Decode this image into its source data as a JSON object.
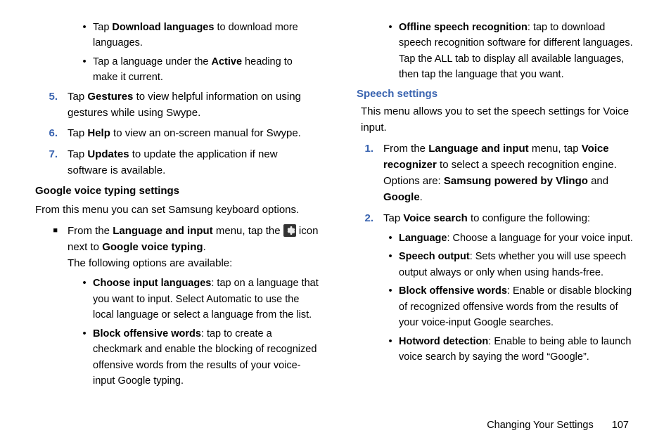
{
  "left": {
    "b_download_pre": "Tap ",
    "b_download_strong": "Download languages",
    "b_download_post": " to download more languages.",
    "b_active_pre": "Tap a language under the ",
    "b_active_strong": "Active",
    "b_active_post": " heading to make it current.",
    "n5_num": "5.",
    "n5_pre": "Tap ",
    "n5_strong": "Gestures",
    "n5_post": " to view helpful information on using gestures while using Swype.",
    "n6_num": "6.",
    "n6_pre": "Tap ",
    "n6_strong": "Help",
    "n6_post": " to view an on-screen manual for Swype.",
    "n7_num": "7.",
    "n7_pre": "Tap ",
    "n7_strong": "Updates",
    "n7_post": " to update the application if new software is available.",
    "h1": "Google voice typing settings",
    "p1": "From this menu you can set Samsung keyboard options.",
    "sq_pre": "From the ",
    "sq_strong1": "Language and input",
    "sq_mid1": " menu, tap the ",
    "sq_mid2": " icon next to ",
    "sq_strong2": "Google voice typing",
    "sq_post": ".",
    "sq_line3": "The following options are available:",
    "bl1_strong": "Choose input languages",
    "bl1_post": ": tap on a language that you want to input. Select Automatic to use the local language or select a language from the list.",
    "bl2_strong": "Block offensive words",
    "bl2_post": ": tap to create a checkmark and enable the blocking of recognized offensive words from the results of your voice-input Google typing."
  },
  "right": {
    "osr_strong": "Offline speech recognition",
    "osr_post": ": tap to download speech recognition software for different languages. Tap the ALL tab to display all available languages, then tap the language that you want.",
    "sec": "Speech settings",
    "p1": "This menu allows you to set the speech settings for Voice input.",
    "n1_num": "1.",
    "n1_pre": "From the ",
    "n1_s1": "Language and input",
    "n1_mid": " menu, tap ",
    "n1_s2": "Voice recognizer",
    "n1_mid2": " to select a speech recognition engine. Options are: ",
    "n1_s3": "Samsung powered by Vlingo",
    "n1_and": " and ",
    "n1_s4": "Google",
    "n1_post": ".",
    "n2_num": "2.",
    "n2_pre": "Tap ",
    "n2_s1": "Voice search",
    "n2_post": " to configure the following:",
    "bl1_strong": "Language",
    "bl1_post": ": Choose a language for your voice input.",
    "bl2_strong": "Speech output",
    "bl2_post": ": Sets whether you will use speech output always or only when using hands-free.",
    "bl3_strong": "Block offensive words",
    "bl3_post": ": Enable or disable blocking of recognized offensive words from the results of your voice-input Google searches.",
    "bl4_strong": "Hotword detection",
    "bl4_post": ": Enable to being able to launch voice search by saying the word “Google”."
  },
  "footer": {
    "label": "Changing Your Settings",
    "page": "107"
  }
}
